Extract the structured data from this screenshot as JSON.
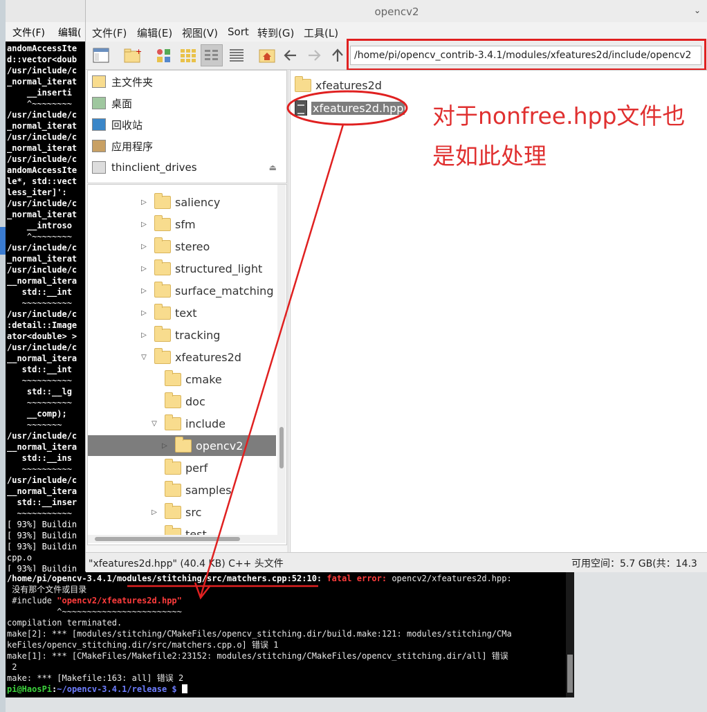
{
  "terminal": {
    "menu": [
      "文件(F)",
      "编辑("
    ],
    "top_lines": [
      {
        "t": "andomAccessIte",
        "c": "cw",
        "b": true
      },
      {
        "t": "d::vector<doub",
        "c": "cw",
        "b": true
      },
      {
        "t": "/usr/include/c",
        "c": "cw",
        "b": true
      },
      {
        "t": "_normal_iterat",
        "c": "cw",
        "b": true
      },
      {
        "t": "    __inserti",
        "c": "cc",
        "b": true
      },
      {
        "t": "    ^~~~~~~~~",
        "c": "cg",
        "b": false
      },
      {
        "t": "/usr/include/c",
        "c": "cw",
        "b": true
      },
      {
        "t": "_normal_iterat",
        "c": "cw",
        "b": true
      },
      {
        "t": "/usr/include/c",
        "c": "cw",
        "b": true
      },
      {
        "t": "_normal_iterat",
        "c": "cw",
        "b": true
      },
      {
        "t": "/usr/include/c",
        "c": "cw",
        "b": true
      },
      {
        "t": "andomAccessIte",
        "c": "cw",
        "b": true
      },
      {
        "t": "le*, std::vect",
        "c": "cw",
        "b": true
      },
      {
        "t": "less_iter]':",
        "c": "cw",
        "b": true
      },
      {
        "t": "/usr/include/c",
        "c": "cw",
        "b": true
      },
      {
        "t": "_normal_iterat",
        "c": "cw",
        "b": true
      },
      {
        "t": "    __introso",
        "c": "cc",
        "b": true
      },
      {
        "t": "    ^~~~~~~~~",
        "c": "cg",
        "b": false
      },
      {
        "t": "/usr/include/c",
        "c": "cw",
        "b": true
      },
      {
        "t": "_normal_iterat",
        "c": "cw",
        "b": true
      },
      {
        "t": "/usr/include/c",
        "c": "cw",
        "b": true
      },
      {
        "t": "__normal_itera",
        "c": "cw",
        "b": true
      },
      {
        "t": "   std::__int",
        "c": "cc",
        "b": true
      },
      {
        "t": "   ~~~~~~~~~~",
        "c": "cg",
        "b": false
      },
      {
        "t": "/usr/include/c",
        "c": "cw",
        "b": true
      },
      {
        "t": ":detail::Image",
        "c": "cw",
        "b": true
      },
      {
        "t": "ator<double> >",
        "c": "cw",
        "b": true
      },
      {
        "t": "/usr/include/c",
        "c": "cw",
        "b": true
      },
      {
        "t": "__normal_itera",
        "c": "cw",
        "b": true
      },
      {
        "t": "   std::__int",
        "c": "cc",
        "b": true
      },
      {
        "t": "   ~~~~~~~~~~",
        "c": "cg",
        "b": false
      },
      {
        "t": "    std::__lg",
        "c": "cc",
        "b": true
      },
      {
        "t": "    ~~~~~~~~~",
        "c": "cg",
        "b": false
      },
      {
        "t": "    __comp);",
        "c": "cc",
        "b": true
      },
      {
        "t": "    ~~~~~~~",
        "c": "cg",
        "b": false
      },
      {
        "t": "/usr/include/c",
        "c": "cw",
        "b": true
      },
      {
        "t": "__normal_itera",
        "c": "cw",
        "b": true
      },
      {
        "t": "   std::__ins",
        "c": "cc",
        "b": true
      },
      {
        "t": "   ~~~~~~~~~~",
        "c": "cg",
        "b": false
      },
      {
        "t": "/usr/include/c",
        "c": "cw",
        "b": true
      },
      {
        "t": "__normal_itera",
        "c": "cw",
        "b": true
      },
      {
        "t": "  std::__inser",
        "c": "cc",
        "b": true
      },
      {
        "t": "  ~~~~~~~~~~~",
        "c": "cg",
        "b": false
      },
      {
        "t": "[ 93%] Buildin",
        "c": "cg",
        "b": false
      },
      {
        "t": "[ 93%] Buildin",
        "c": "cg",
        "b": false
      },
      {
        "t": "[ 93%] Buildin",
        "c": "cg",
        "b": false
      },
      {
        "t": "cpp.o",
        "c": "cg",
        "b": false
      },
      {
        "t": "[ 93%] Buildin",
        "c": "cg",
        "b": false
      }
    ],
    "error_path": "/home/pi/opencv-3.4.1/modules/stitching/src/matchers.cpp:52:10:",
    "error_word": "fatal error:",
    "error_msg": " opencv2/xfeatures2d.hpp:",
    "no_such_file": " 没有那个文件或目录",
    "include_directive": " #include ",
    "include_target": "\"opencv2/xfeatures2d.hpp\"",
    "include_marker": "          ^~~~~~~~~~~~~~~~~~~~~~~~~",
    "lines_after": [
      "compilation terminated.",
      "make[2]: *** [modules/stitching/CMakeFiles/opencv_stitching.dir/build.make:121: modules/stitching/CMa",
      "keFiles/opencv_stitching.dir/src/matchers.cpp.o] 错误 1",
      "make[1]: *** [CMakeFiles/Makefile2:23152: modules/stitching/CMakeFiles/opencv_stitching.dir/all] 错误",
      " 2",
      "make: *** [Makefile:163: all] 错误 2"
    ],
    "prompt_user": "pi@HaosPi",
    "prompt_sep": ":",
    "prompt_path": "~/opencv-3.4.1/release $",
    "prompt_space": " "
  },
  "file_manager": {
    "title": "opencv2",
    "menu": [
      "文件(F)",
      "编辑(E)",
      "视图(V)",
      "Sort",
      "转到(G)",
      "工具(L)"
    ],
    "path": "/home/pi/opencv_contrib-3.4.1/modules/xfeatures2d/include/opencv2",
    "places": [
      {
        "label": "主文件夹",
        "icon": "home-icon"
      },
      {
        "label": "桌面",
        "icon": "desktop-icon"
      },
      {
        "label": "回收站",
        "icon": "trash-icon"
      },
      {
        "label": "应用程序",
        "icon": "applications-icon"
      },
      {
        "label": "thinclient_drives",
        "icon": "drive-icon"
      }
    ],
    "eject": "⏏",
    "tree": [
      {
        "label": "saliency",
        "indent": 0,
        "expander": "▷"
      },
      {
        "label": "sfm",
        "indent": 0,
        "expander": "▷"
      },
      {
        "label": "stereo",
        "indent": 0,
        "expander": "▷"
      },
      {
        "label": "structured_light",
        "indent": 0,
        "expander": "▷"
      },
      {
        "label": "surface_matching",
        "indent": 0,
        "expander": "▷"
      },
      {
        "label": "text",
        "indent": 0,
        "expander": "▷"
      },
      {
        "label": "tracking",
        "indent": 0,
        "expander": "▷"
      },
      {
        "label": "xfeatures2d",
        "indent": 0,
        "expander": "▽"
      },
      {
        "label": "cmake",
        "indent": 1,
        "expander": ""
      },
      {
        "label": "doc",
        "indent": 1,
        "expander": ""
      },
      {
        "label": "include",
        "indent": 1,
        "expander": "▽"
      },
      {
        "label": "opencv2",
        "indent": 2,
        "expander": "▷",
        "selected": true
      },
      {
        "label": "perf",
        "indent": 1,
        "expander": ""
      },
      {
        "label": "samples",
        "indent": 1,
        "expander": ""
      },
      {
        "label": "src",
        "indent": 1,
        "expander": "▷"
      },
      {
        "label": "test",
        "indent": 1,
        "expander": ""
      }
    ],
    "files": [
      {
        "label": "xfeatures2d",
        "type": "folder"
      },
      {
        "label": "xfeatures2d.hpp",
        "type": "file",
        "selected": true
      }
    ],
    "annotation": "对于nonfree.hpp文件也是如此处理",
    "status_left": "\"xfeatures2d.hpp\" (40.4 KB) C++ 头文件",
    "status_right": "可用空间：5.7 GB(共：14.3",
    "colors": {
      "annotation": "#e03030",
      "selection": "#7d7d7d"
    }
  }
}
